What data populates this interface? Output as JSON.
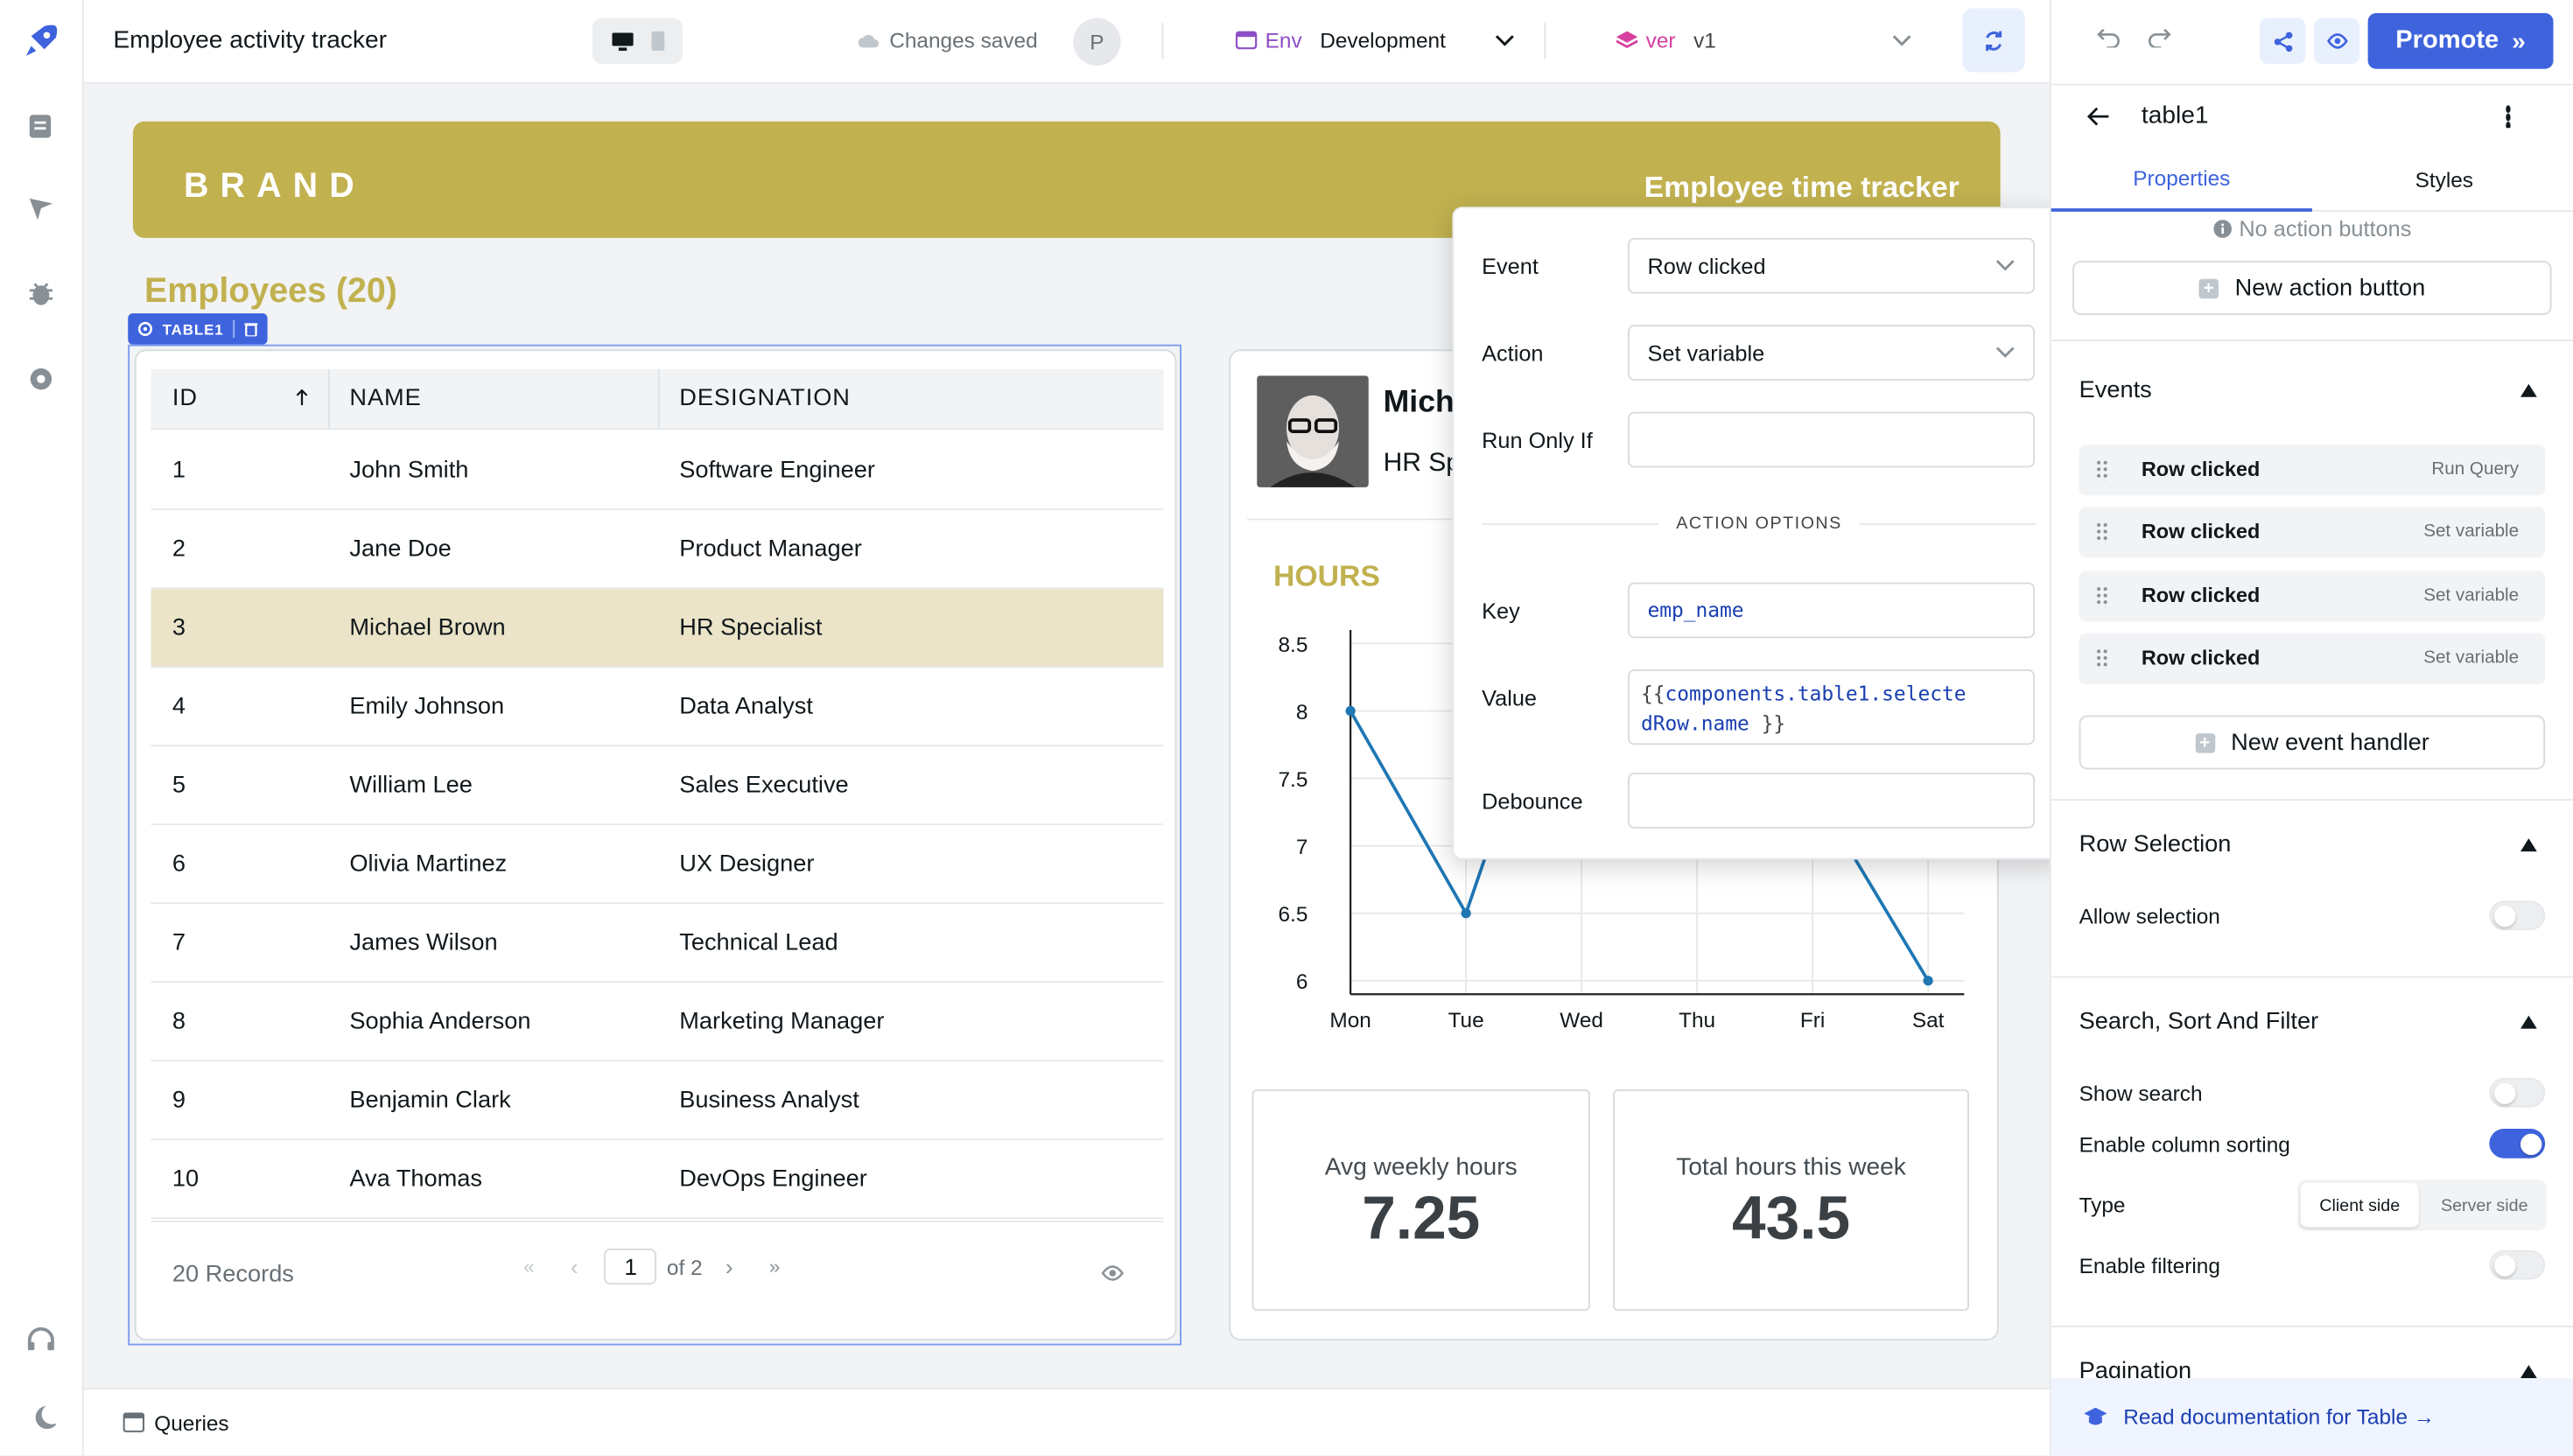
{
  "app": {
    "title": "Employee activity tracker",
    "saved_status": "Changes saved",
    "user_initial": "P"
  },
  "env": {
    "label": "Env",
    "value": "Development"
  },
  "version": {
    "label": "ver",
    "value": "v1"
  },
  "header_banner": {
    "brand": "BRAND",
    "subtitle": "Employee time tracker"
  },
  "employees_title": "Employees (20)",
  "table": {
    "tag": "TABLE1",
    "columns": [
      "ID",
      "NAME",
      "DESIGNATION"
    ],
    "rows": [
      {
        "id": "1",
        "name": "John Smith",
        "designation": "Software Engineer"
      },
      {
        "id": "2",
        "name": "Jane Doe",
        "designation": "Product Manager"
      },
      {
        "id": "3",
        "name": "Michael Brown",
        "designation": "HR Specialist"
      },
      {
        "id": "4",
        "name": "Emily Johnson",
        "designation": "Data Analyst"
      },
      {
        "id": "5",
        "name": "William Lee",
        "designation": "Sales Executive"
      },
      {
        "id": "6",
        "name": "Olivia Martinez",
        "designation": "UX Designer"
      },
      {
        "id": "7",
        "name": "James Wilson",
        "designation": "Technical Lead"
      },
      {
        "id": "8",
        "name": "Sophia Anderson",
        "designation": "Marketing Manager"
      },
      {
        "id": "9",
        "name": "Benjamin Clark",
        "designation": "Business Analyst"
      },
      {
        "id": "10",
        "name": "Ava Thomas",
        "designation": "DevOps Engineer"
      }
    ],
    "selected_row": 2,
    "records": "20 Records",
    "page": "1",
    "page_of": "of 2"
  },
  "profile": {
    "name": "Mich",
    "designation": "HR Sp"
  },
  "hours_title": "HOURS",
  "chart_data": {
    "type": "line",
    "categories": [
      "Mon",
      "Tue",
      "Wed",
      "Thu",
      "Fri",
      "Sat"
    ],
    "values": [
      8,
      6.5,
      null,
      7,
      null,
      6
    ],
    "yticks": [
      "8.5",
      "8",
      "7.5",
      "7",
      "6.5",
      "6"
    ],
    "ylim": [
      5.9,
      8.6
    ],
    "color": "#1f77b4"
  },
  "stats": [
    {
      "label": "Avg weekly hours",
      "value": "7.25"
    },
    {
      "label": "Total hours this week",
      "value": "43.5"
    }
  ],
  "popover": {
    "event_label": "Event",
    "event_value": "Row clicked",
    "action_label": "Action",
    "action_value": "Set variable",
    "run_only_if_label": "Run Only If",
    "section": "ACTION OPTIONS",
    "key_label": "Key",
    "key_value": "emp_name",
    "value_label": "Value",
    "value_code_1": "components.table1.selecte",
    "value_code_2": "dRow.name",
    "debounce_label": "Debounce"
  },
  "inspector": {
    "component": "table1",
    "tabs": [
      "Properties",
      "Styles"
    ],
    "no_action_buttons": "No action buttons",
    "new_action_button": "New action button",
    "events_title": "Events",
    "events": [
      {
        "event": "Row clicked",
        "action": "Run Query"
      },
      {
        "event": "Row clicked",
        "action": "Set variable"
      },
      {
        "event": "Row clicked",
        "action": "Set variable"
      },
      {
        "event": "Row clicked",
        "action": "Set variable"
      }
    ],
    "new_event_handler": "New event handler",
    "row_selection_title": "Row Selection",
    "allow_selection": "Allow selection",
    "ssf_title": "Search, Sort And Filter",
    "show_search": "Show search",
    "enable_column_sorting": "Enable column sorting",
    "type_label": "Type",
    "type_options": [
      "Client side",
      "Server side"
    ],
    "enable_filtering": "Enable filtering",
    "pagination_title": "Pagination",
    "read_docs": "Read documentation for Table →"
  },
  "promote_label": "Promote",
  "queries_label": "Queries",
  "accent_color": "#3e63dd",
  "brand_color": "#c1b14f"
}
